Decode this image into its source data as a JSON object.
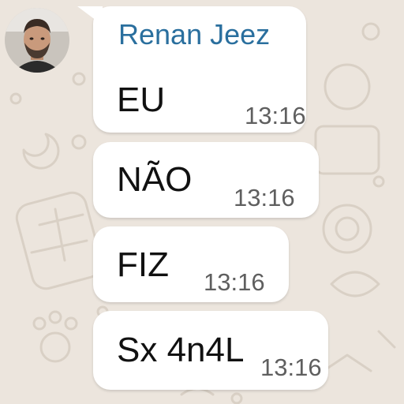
{
  "contact": {
    "name": "Renan Jeez",
    "avatar_icon": "profile-photo",
    "name_color": "#2a6f9e"
  },
  "messages": [
    {
      "text": "EU",
      "time": "13:16"
    },
    {
      "text": "NÃO",
      "time": "13:16"
    },
    {
      "text": "FIZ",
      "time": "13:16"
    },
    {
      "text": "Sx 4n4L",
      "time": "13:16"
    }
  ],
  "theme": {
    "background": "#ece5dd",
    "bubble": "#ffffff"
  }
}
